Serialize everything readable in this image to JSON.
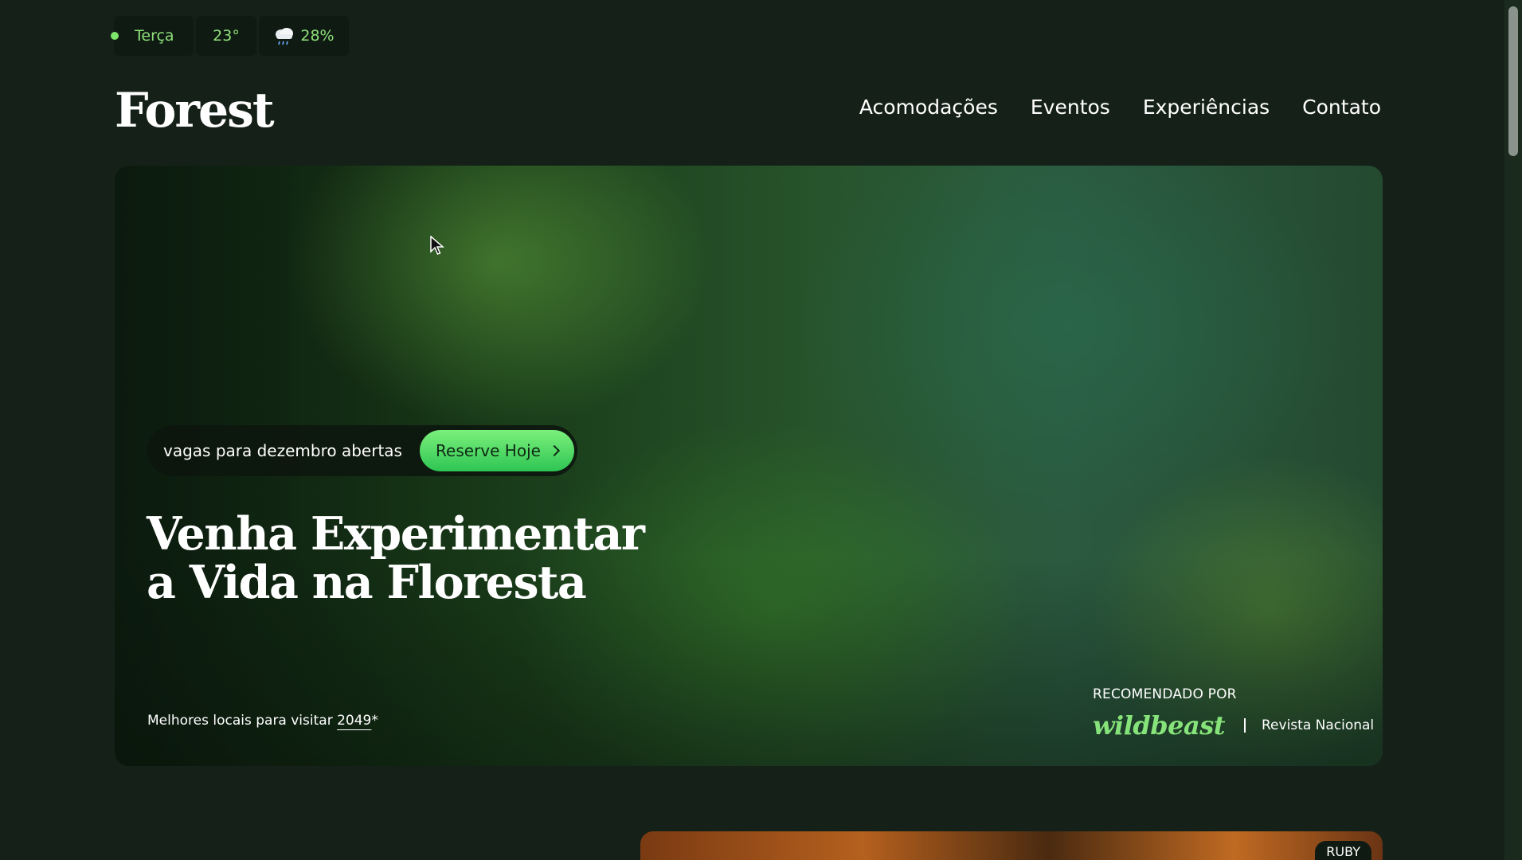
{
  "weather": {
    "day": "Terça",
    "temperature": "23°",
    "rain_chance": "28%",
    "icon": "rain-cloud-icon",
    "status_color": "#7ee46a"
  },
  "header": {
    "logo": "Forest",
    "nav": [
      {
        "label": "Acomodações"
      },
      {
        "label": "Eventos"
      },
      {
        "label": "Experiências"
      },
      {
        "label": "Contato"
      }
    ]
  },
  "hero": {
    "promo_text": "vagas para dezembro abertas",
    "cta_label": "Reserve Hoje",
    "title_line1": "Venha Experimentar",
    "title_line2": "a Vida na Floresta",
    "best_places_text": "Melhores locais para visitar",
    "best_places_year": "2049",
    "best_places_suffix": "*",
    "recommended_label": "RECOMENDADO POR",
    "recommended_brand": "wildbeast",
    "recommended_other": "Revista Nacional"
  },
  "lower": {
    "badge": "RUBY"
  },
  "colors": {
    "accent": "#2ec553",
    "accent_light": "#7cf07c",
    "background": "#152118",
    "brand_green": "#86e37a"
  }
}
